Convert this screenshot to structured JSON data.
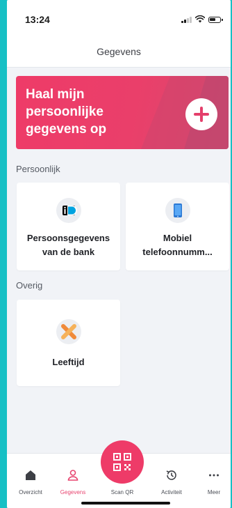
{
  "status_bar": {
    "time": "13:24",
    "icons": [
      "signal-icon",
      "wifi-icon",
      "battery-icon"
    ]
  },
  "header": {
    "title": "Gegevens"
  },
  "banner": {
    "text": "Haal mijn persoonlijke gegevens op",
    "icon": "plus-icon",
    "color": "#ee3b68"
  },
  "sections": {
    "personal": {
      "label": "Persoonlijk",
      "cards": [
        {
          "label": "Persoonsgegevens van de bank",
          "icon": "idin-icon"
        },
        {
          "label": "Mobiel telefoonnumm...",
          "icon": "mobile-phone-icon"
        }
      ]
    },
    "other": {
      "label": "Overig",
      "cards": [
        {
          "label": "Leeftijd",
          "icon": "age-icon"
        }
      ]
    }
  },
  "tab_bar": {
    "items": [
      {
        "label": "Overzicht",
        "icon": "home-icon",
        "active": false
      },
      {
        "label": "Gegevens",
        "icon": "person-icon",
        "active": true
      },
      {
        "label": "Scan QR",
        "icon": "qr-code-icon",
        "active": false
      },
      {
        "label": "Activiteit",
        "icon": "history-icon",
        "active": false
      },
      {
        "label": "Meer",
        "icon": "more-icon",
        "active": false
      }
    ],
    "accent_color": "#e8446f"
  }
}
